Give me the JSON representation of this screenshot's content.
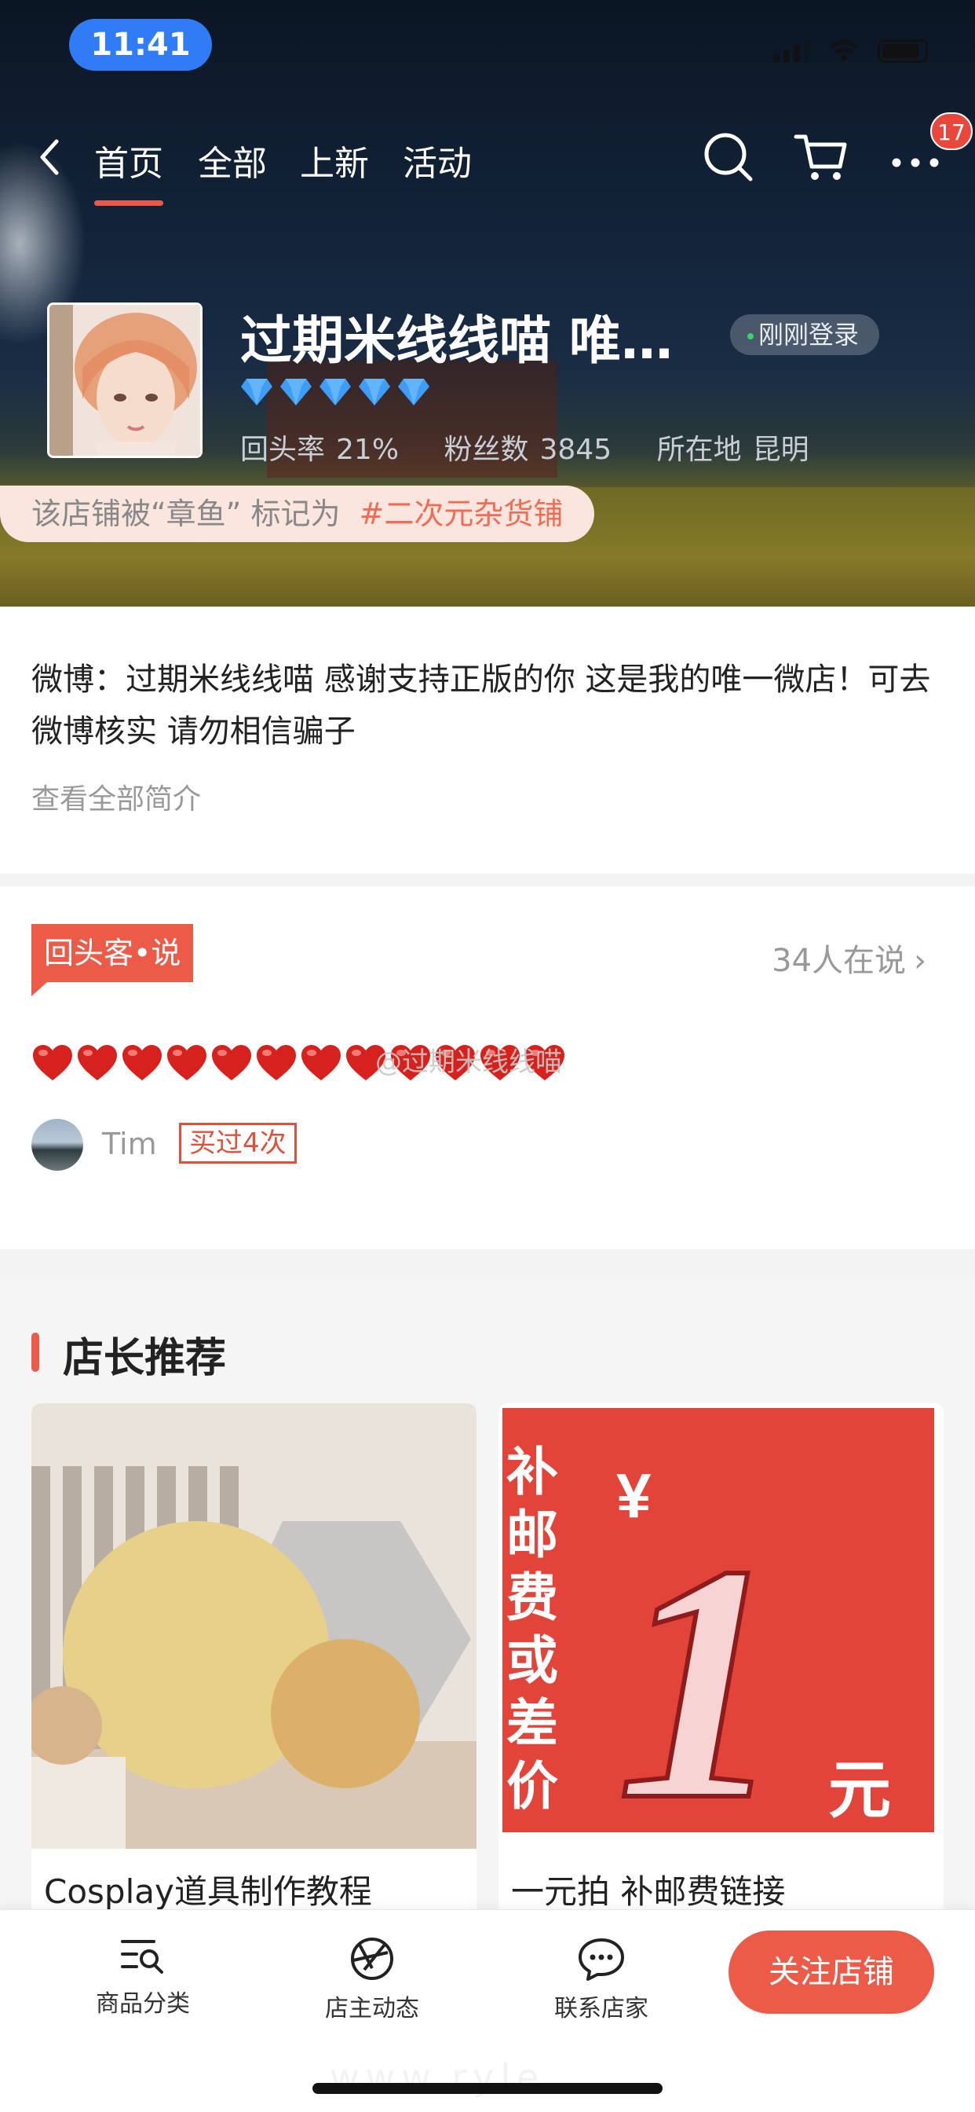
{
  "status_bar": {
    "time": "11:41"
  },
  "nav": {
    "tabs": [
      {
        "label": "首页",
        "active": true
      },
      {
        "label": "全部",
        "active": false
      },
      {
        "label": "上新",
        "active": false
      },
      {
        "label": "活动",
        "active": false
      }
    ],
    "icons": [
      "back-icon",
      "search-icon",
      "cart-icon",
      "more-icon"
    ],
    "notification_count": "17"
  },
  "shop": {
    "name": "过期米线线喵 唯…",
    "status": "刚刚登录",
    "diamond_level": 5,
    "stats": [
      {
        "label": "回头率",
        "value": "21%"
      },
      {
        "label": "粉丝数",
        "value": "3845"
      },
      {
        "label": "所在地",
        "value": "昆明"
      }
    ],
    "tag_prefix": "该店铺被“章鱼” 标记为",
    "tag_highlight": "#二次元杂货铺"
  },
  "intro": {
    "text": "微博：过期米线线喵 感谢支持正版的你 这是我的唯一微店！可去微博核实 请勿相信骗子",
    "more_label": "查看全部简介"
  },
  "reviews": {
    "tag_label": "回头客•说",
    "count_label": "34人在说",
    "hearts": "❤️❤️❤️❤️❤️❤️❤️❤️❤️❤️❤️❤️",
    "watermark": "@过期米线线喵",
    "reviewer_name": "Tim",
    "bought_label": "买过4次"
  },
  "recommend": {
    "title": "店长推荐",
    "items": [
      {
        "title": "Cosplay道具制作教程"
      },
      {
        "title": "一元拍 补邮费链接",
        "image_text": "补邮费或差价",
        "currency": "¥",
        "amount": "1",
        "unit": "元"
      }
    ]
  },
  "bottom_bar": {
    "items": [
      {
        "label": "商品分类",
        "icon": "category-list-icon"
      },
      {
        "label": "店主动态",
        "icon": "aperture-icon"
      },
      {
        "label": "联系店家",
        "icon": "chat-bubble-icon"
      }
    ],
    "follow_label": "关注店铺",
    "watermark": "www.ryle"
  },
  "colors": {
    "accent": "#ec5b47",
    "time_pill": "#2f7cf6",
    "tag_highlight": "#f06c52"
  }
}
